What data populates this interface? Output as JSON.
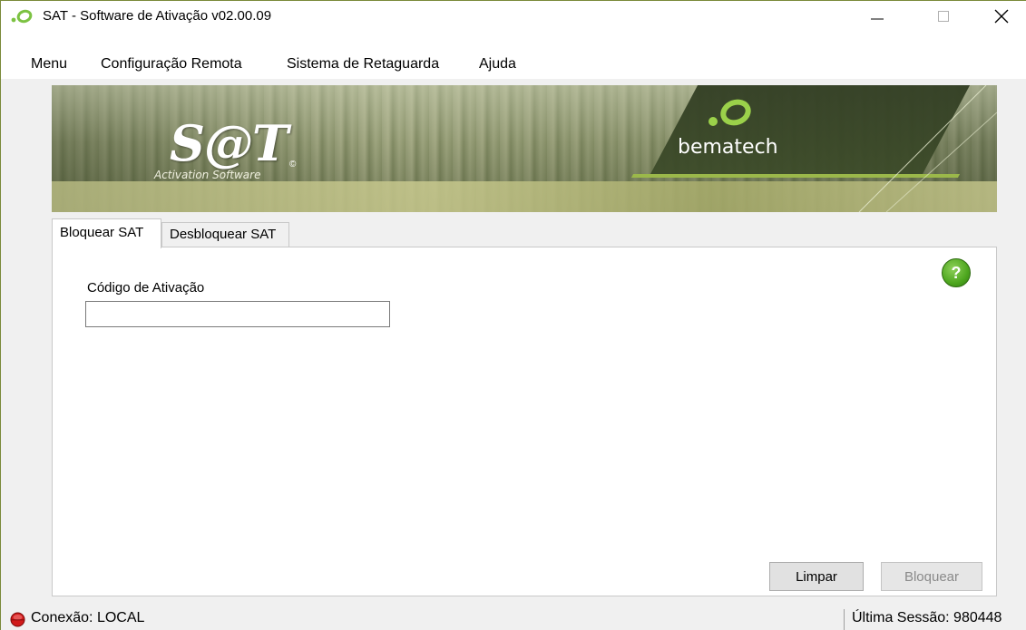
{
  "window": {
    "title": "SAT - Software de Ativação v02.00.09",
    "minimize_glyph": "—",
    "maximize_glyph": "☐",
    "close_glyph": "✕"
  },
  "menu": {
    "items": [
      "Menu",
      "Configuração Remota",
      "Sistema de Retaguarda",
      "Ajuda"
    ]
  },
  "banner": {
    "sat_logo": "S@T",
    "sat_subtitle": "Activation Software",
    "sat_copyright": "©",
    "brand": "bematech"
  },
  "tabs": [
    {
      "label": "Bloquear SAT",
      "active": true
    },
    {
      "label": "Desbloquear SAT",
      "active": false
    }
  ],
  "form": {
    "help_label": "?",
    "activation_code_label": "Código de Ativação",
    "activation_code_value": "",
    "clear_button": "Limpar",
    "lock_button": "Bloquear",
    "lock_button_enabled": false
  },
  "status": {
    "connection": "Conexão: LOCAL",
    "last_session": "Última Sessão: 980448"
  },
  "colors": {
    "accent_green": "#4da61e",
    "brand_green": "#9bb84a",
    "status_red": "#d11a1a"
  }
}
